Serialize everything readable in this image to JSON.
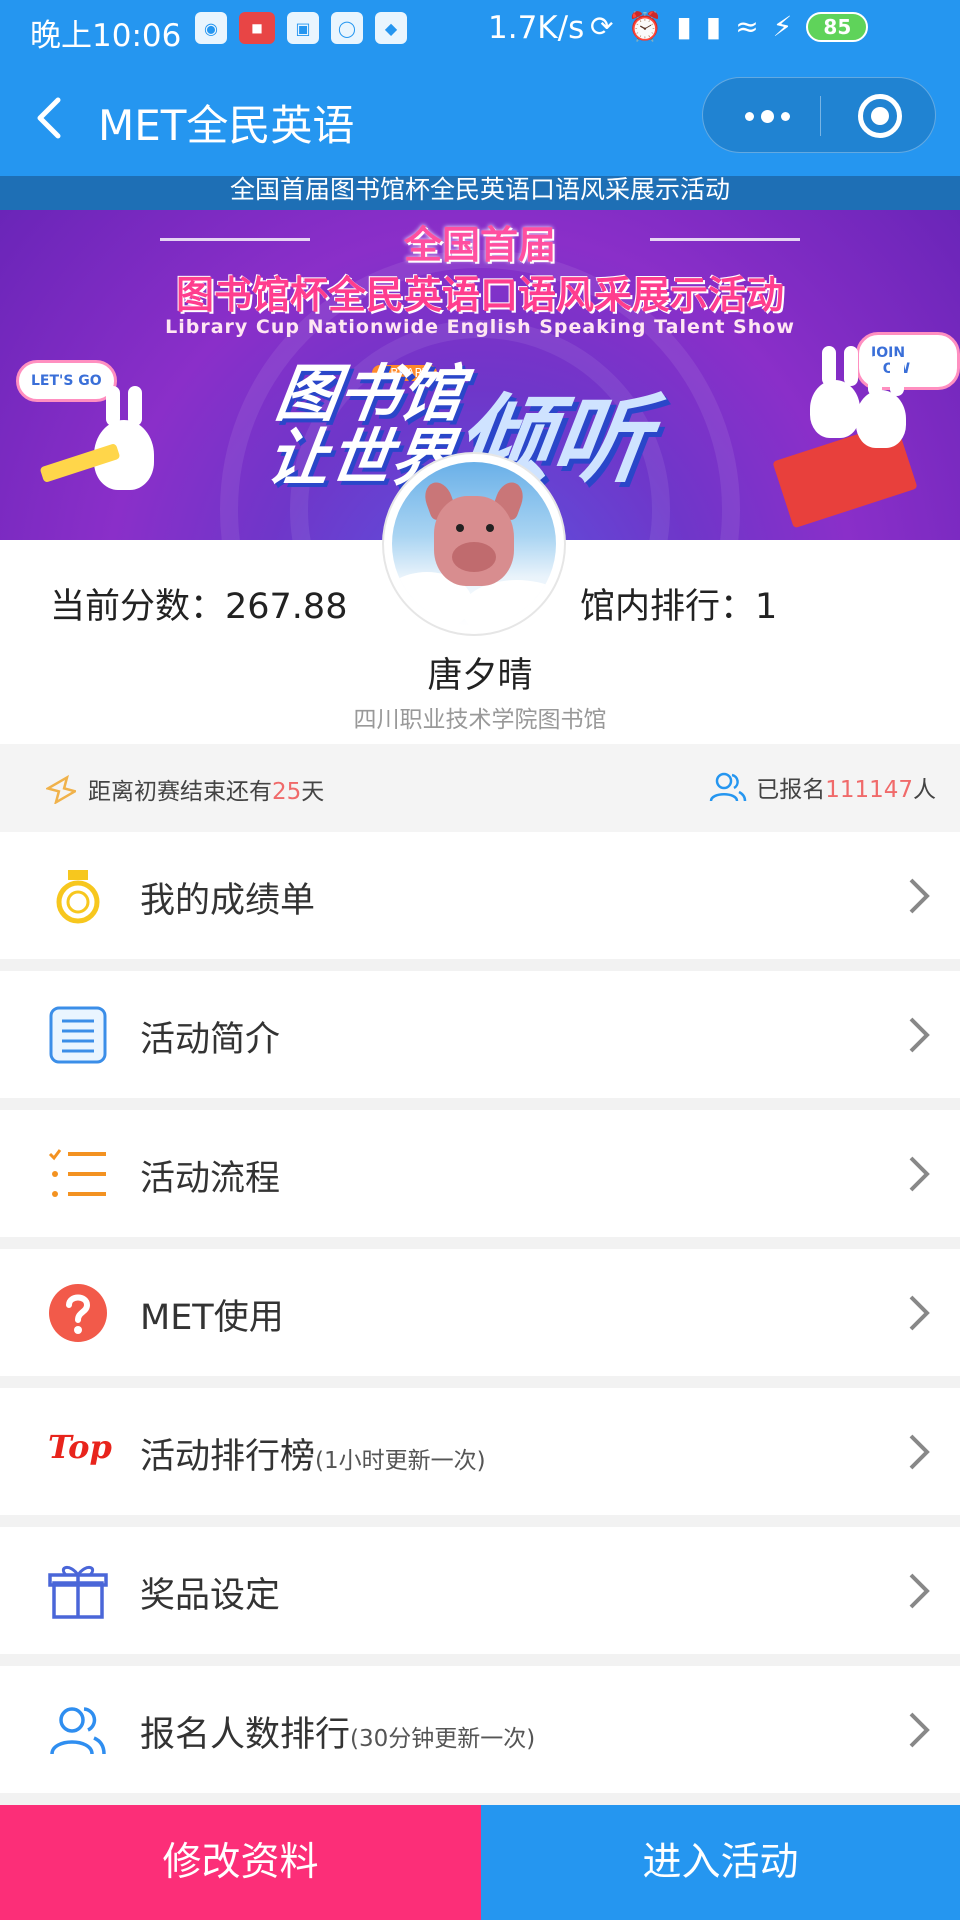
{
  "status_bar": {
    "time": "晚上10:06",
    "network_speed": "1.7K/s",
    "battery": "85"
  },
  "nav": {
    "title": "MET全民英语"
  },
  "banner": {
    "strip_text": "全国首届图书馆杯全民英语口语风采展示活动",
    "line1": "全国首届",
    "line2": "图书馆杯全民英语口语风采展示活动",
    "line3": "Library Cup Nationwide English Speaking Talent Show",
    "slogan_left": "图书馆让世界",
    "slogan_right": "倾听",
    "library_tag": "LIBRARY",
    "bubble_left": "LET'S GO",
    "bubble_right": "JOIN NOW"
  },
  "profile": {
    "score": "当前分数：267.88",
    "rank": "馆内排行：1",
    "name": "唐夕晴",
    "library": "四川职业技术学院图书馆"
  },
  "info": {
    "countdown_prefix": "距离初赛结束还有",
    "countdown_days": "25",
    "countdown_suffix": "天",
    "signed_prefix": "已报名",
    "signed_count": "111147",
    "signed_suffix": "人"
  },
  "menu": [
    {
      "label": "我的成绩单",
      "note": "",
      "icon": "medal-icon"
    },
    {
      "label": "活动简介",
      "note": "",
      "icon": "document-icon"
    },
    {
      "label": "活动流程",
      "note": "",
      "icon": "checklist-icon"
    },
    {
      "label": "MET使用",
      "note": "",
      "icon": "help-icon"
    },
    {
      "label": "活动排行榜",
      "note": "(1小时更新一次)",
      "icon": "top-icon"
    },
    {
      "label": "奖品设定",
      "note": "",
      "icon": "gift-icon"
    },
    {
      "label": "报名人数排行",
      "note": "(30分钟更新一次)",
      "icon": "users-icon"
    }
  ],
  "buttons": {
    "edit": "修改资料",
    "enter": "进入活动"
  },
  "top_icon_text": "Top",
  "colors": {
    "primary": "#2596f0",
    "accent_pink": "#fc2e78",
    "highlight": "#f06a6a"
  }
}
